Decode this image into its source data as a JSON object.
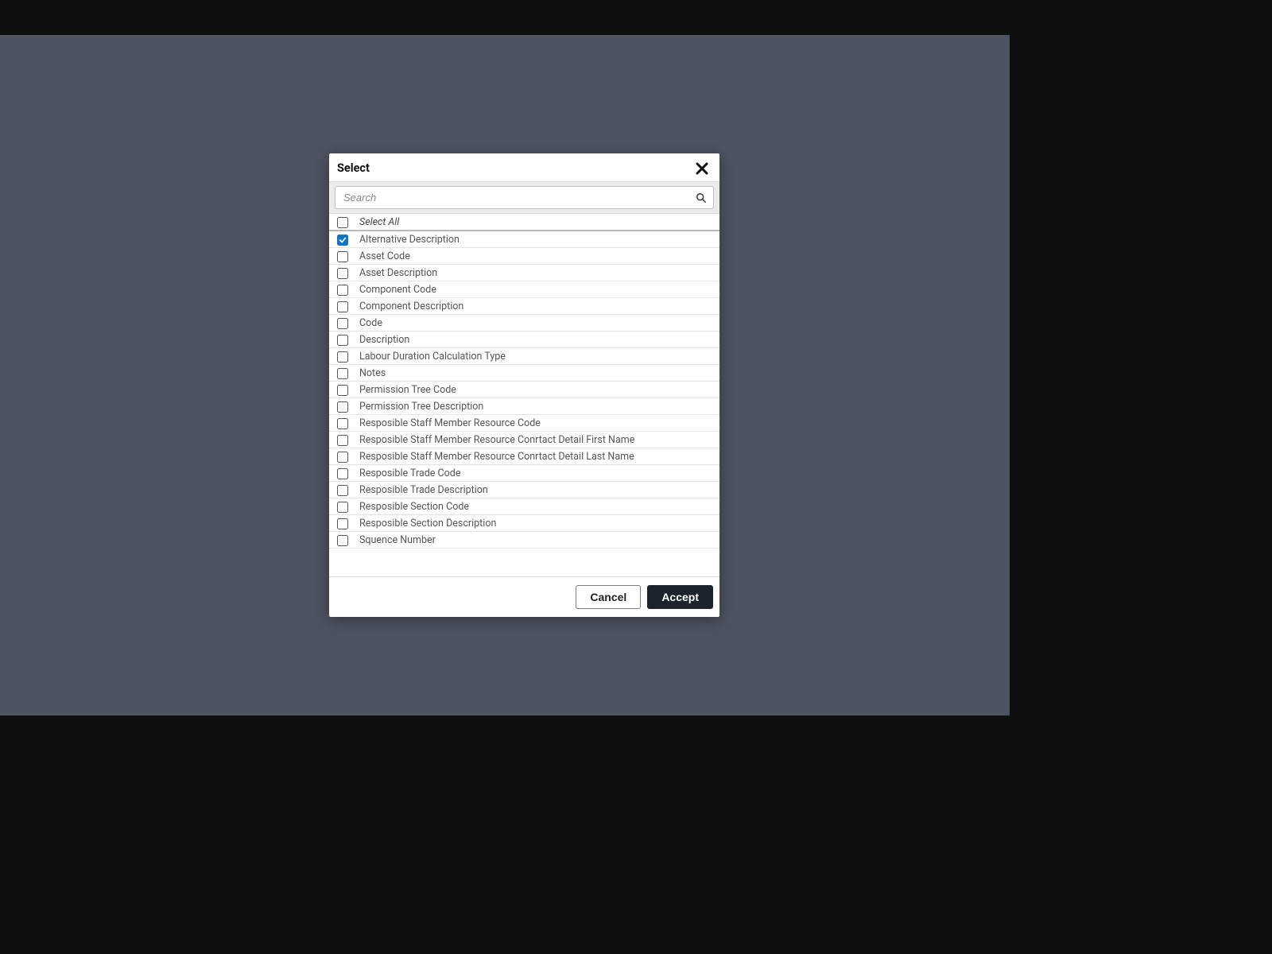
{
  "modal": {
    "title": "Select",
    "search_placeholder": "Search",
    "select_all_label": "Select All",
    "items": [
      {
        "label": "Alternative Description",
        "checked": true
      },
      {
        "label": "Asset Code",
        "checked": false
      },
      {
        "label": "Asset Description",
        "checked": false
      },
      {
        "label": "Component Code",
        "checked": false
      },
      {
        "label": "Component Description",
        "checked": false
      },
      {
        "label": "Code",
        "checked": false
      },
      {
        "label": "Description",
        "checked": false
      },
      {
        "label": "Labour Duration Calculation Type",
        "checked": false
      },
      {
        "label": "Notes",
        "checked": false
      },
      {
        "label": "Permission Tree Code",
        "checked": false
      },
      {
        "label": "Permission Tree Description",
        "checked": false
      },
      {
        "label": "Resposible Staff Member Resource Code",
        "checked": false
      },
      {
        "label": "Resposible Staff Member Resource Conrtact Detail First Name",
        "checked": false
      },
      {
        "label": "Resposible Staff Member Resource Conrtact Detail Last Name",
        "checked": false
      },
      {
        "label": "Resposible Trade Code",
        "checked": false
      },
      {
        "label": "Resposible Trade Description",
        "checked": false
      },
      {
        "label": "Resposible Section Code",
        "checked": false
      },
      {
        "label": "Resposible Section Description",
        "checked": false
      },
      {
        "label": "Squence Number",
        "checked": false
      }
    ],
    "cancel_label": "Cancel",
    "accept_label": "Accept"
  }
}
